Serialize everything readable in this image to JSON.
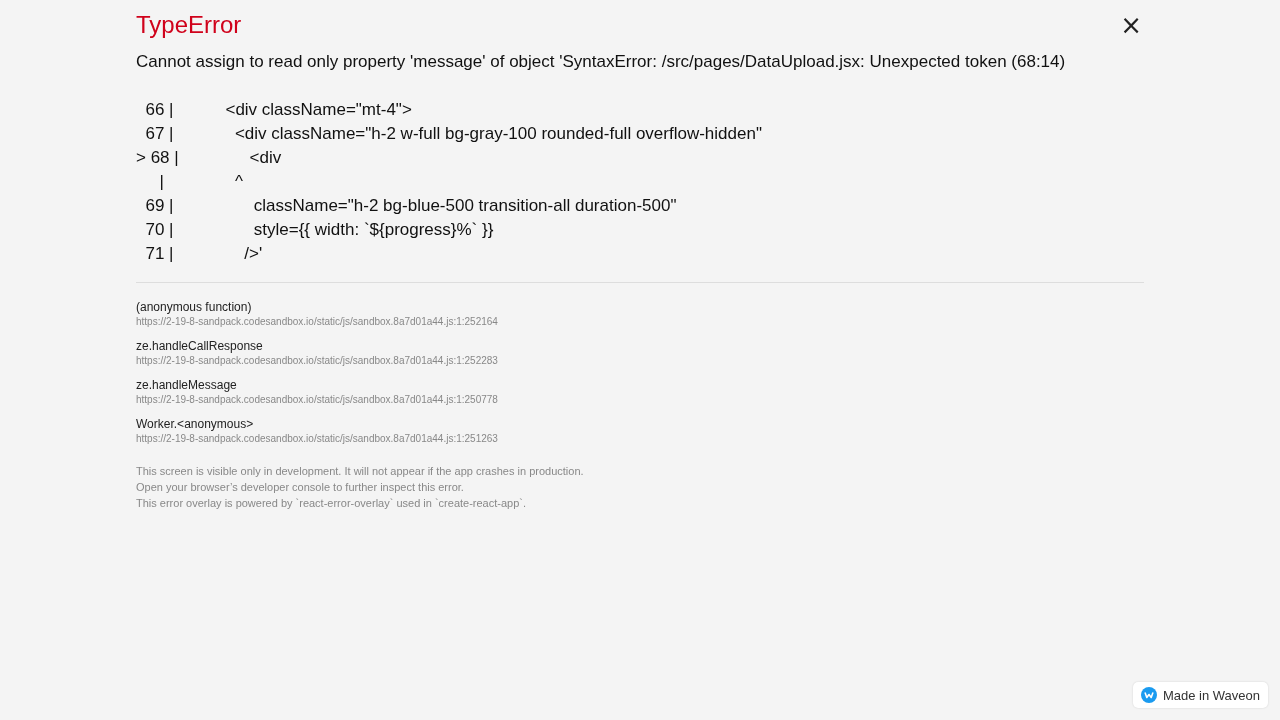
{
  "header": {
    "title": "TypeError",
    "close": "×"
  },
  "message": "Cannot assign to read only property 'message' of object 'SyntaxError: /src/pages/DataUpload.jsx: Unexpected token (68:14)",
  "code_frame": [
    "  66 |           <div className=\"mt-4\">",
    "  67 |             <div className=\"h-2 w-full bg-gray-100 rounded-full overflow-hidden\"",
    "> 68 |               <div",
    "     |               ^",
    "  69 |                 className=\"h-2 bg-blue-500 transition-all duration-500\"",
    "  70 |                 style={{ width: `${progress}%` }}",
    "  71 |               />'"
  ],
  "stack_frames": [
    {
      "function": "(anonymous function)",
      "location": "https://2-19-8-sandpack.codesandbox.io/static/js/sandbox.8a7d01a44.js:1:252164"
    },
    {
      "function": "ze.handleCallResponse",
      "location": "https://2-19-8-sandpack.codesandbox.io/static/js/sandbox.8a7d01a44.js:1:252283"
    },
    {
      "function": "ze.handleMessage",
      "location": "https://2-19-8-sandpack.codesandbox.io/static/js/sandbox.8a7d01a44.js:1:250778"
    },
    {
      "function": "Worker.<anonymous>",
      "location": "https://2-19-8-sandpack.codesandbox.io/static/js/sandbox.8a7d01a44.js:1:251263"
    }
  ],
  "footer": [
    "This screen is visible only in development. It will not appear if the app crashes in production.",
    "Open your browser’s developer console to further inspect this error.",
    "This error overlay is powered by `react-error-overlay` used in `create-react-app`."
  ],
  "badge": {
    "label": "Made in Waveon"
  }
}
